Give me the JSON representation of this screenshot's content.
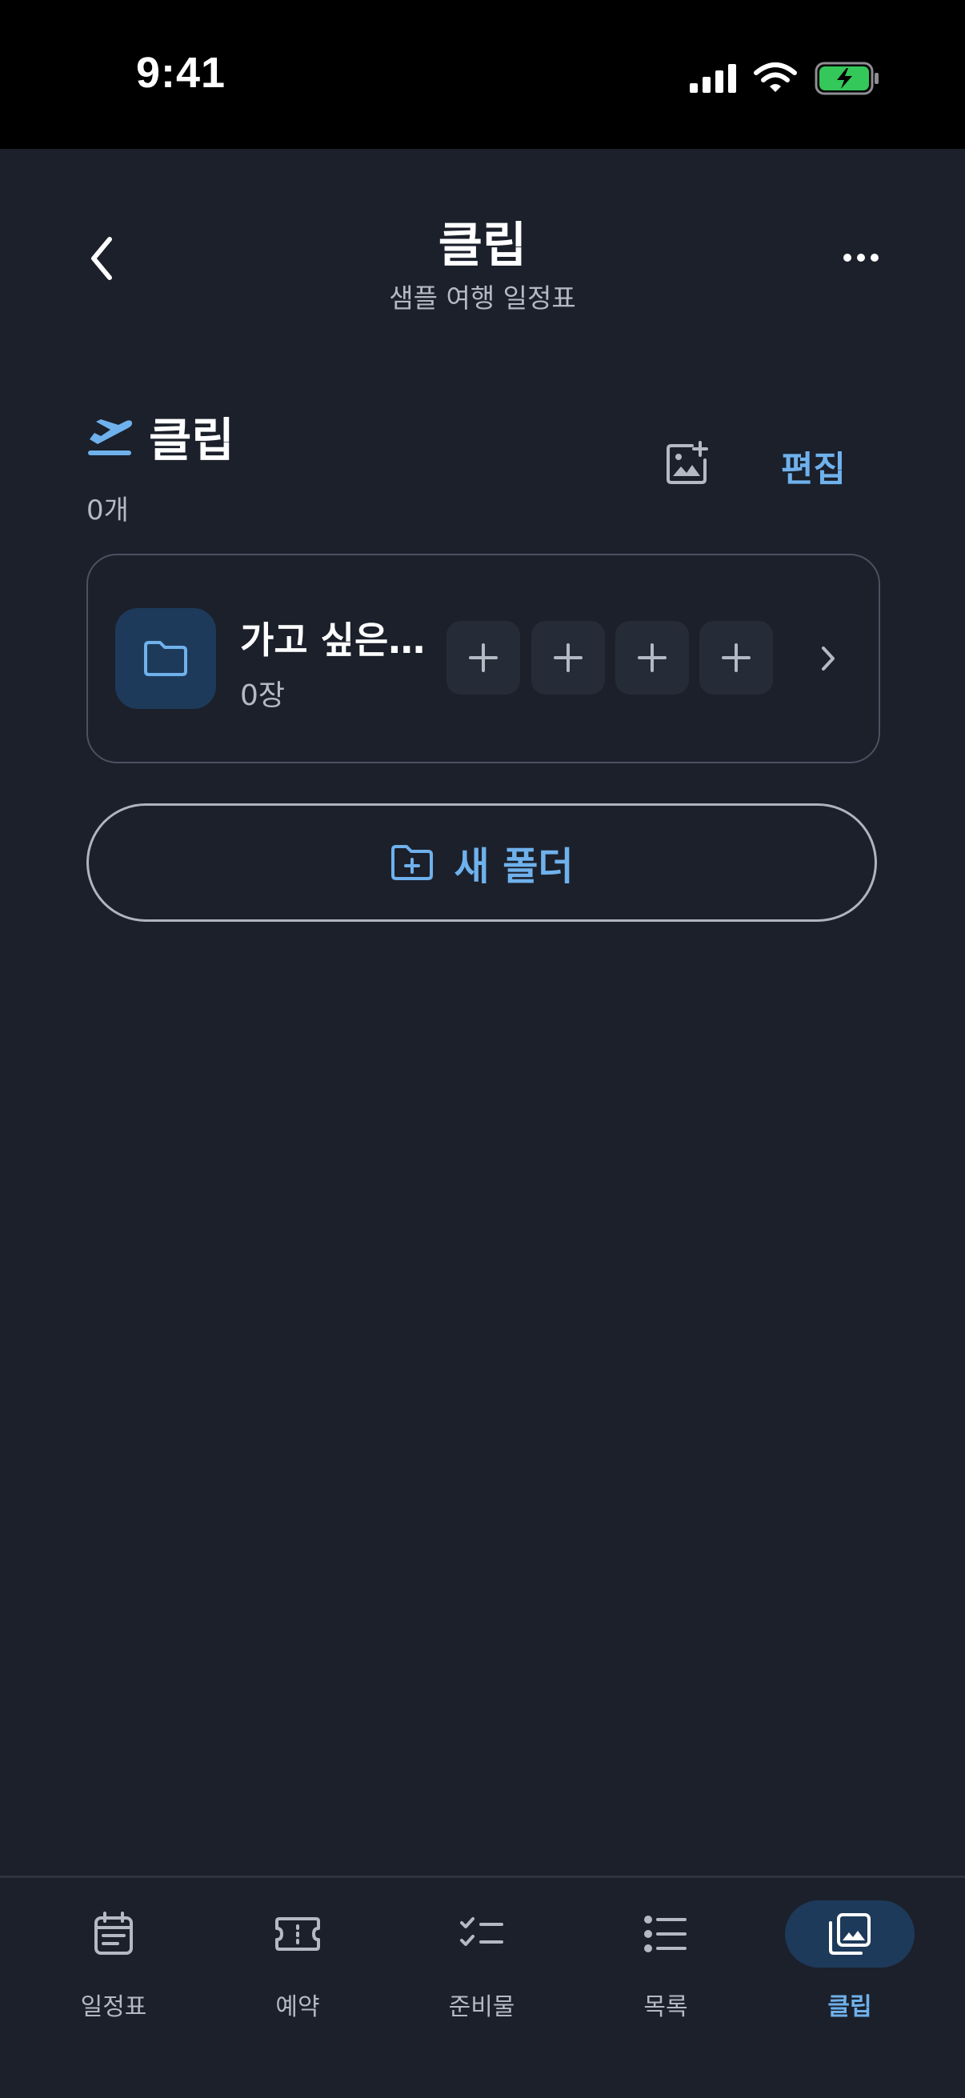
{
  "status_bar": {
    "time": "9:41"
  },
  "header": {
    "title": "클립",
    "subtitle": "샘플 여행 일정표"
  },
  "section": {
    "title": "클립",
    "count": "0개",
    "edit_label": "편집"
  },
  "folders": [
    {
      "name": "가고 싶은…",
      "count": "0장"
    }
  ],
  "new_folder": {
    "label": "새 폴더"
  },
  "tabs": [
    {
      "label": "일정표",
      "icon": "calendar-icon",
      "active": false
    },
    {
      "label": "예약",
      "icon": "ticket-icon",
      "active": false
    },
    {
      "label": "준비물",
      "icon": "checklist-icon",
      "active": false
    },
    {
      "label": "목록",
      "icon": "list-icon",
      "active": false
    },
    {
      "label": "클립",
      "icon": "photo-library-icon",
      "active": true
    }
  ],
  "colors": {
    "background": "#1b202b",
    "accent": "#6fb1ec",
    "accent_bg": "#1e3a5a",
    "battery": "#34c759"
  }
}
